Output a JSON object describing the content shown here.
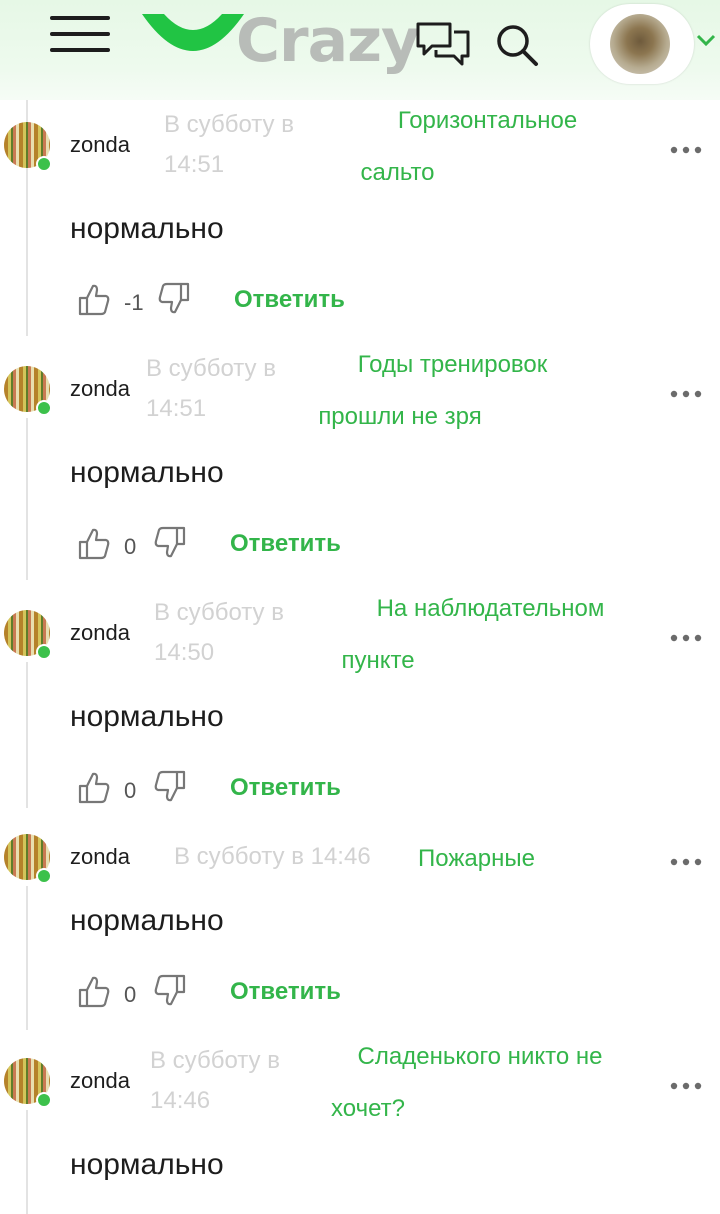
{
  "header": {
    "logo_text": "Crazy",
    "brand_green": "#21c444",
    "icons": [
      "menu-icon",
      "chat-icon",
      "search-icon",
      "chevron-down-icon"
    ]
  },
  "comments": [
    {
      "user": "zonda",
      "date_line1": "В субботу в",
      "date_line2": "14:51",
      "title_line1": "Горизонтальное",
      "title_line2": "сальто",
      "text": "нормально",
      "score": "-1",
      "reply": "Ответить"
    },
    {
      "user": "zonda",
      "date_line1": "В субботу в",
      "date_line2": "14:51",
      "title_line1": "Годы тренировок",
      "title_line2": "прошли не зря",
      "text": "нормально",
      "score": "0",
      "reply": "Ответить"
    },
    {
      "user": "zonda",
      "date_line1": "В субботу в",
      "date_line2": "14:50",
      "title_line1": "На наблюдательном",
      "title_line2": "пункте",
      "text": "нормально",
      "score": "0",
      "reply": "Ответить"
    },
    {
      "user": "zonda",
      "date": "В субботу в 14:46",
      "title": "Пожарные",
      "text": "нормально",
      "score": "0",
      "reply": "Ответить"
    },
    {
      "user": "zonda",
      "date_line1": "В субботу в",
      "date_line2": "14:46",
      "title_line1": "Сладенького никто не",
      "title_line2": "хочет?",
      "text": "нормально"
    }
  ]
}
